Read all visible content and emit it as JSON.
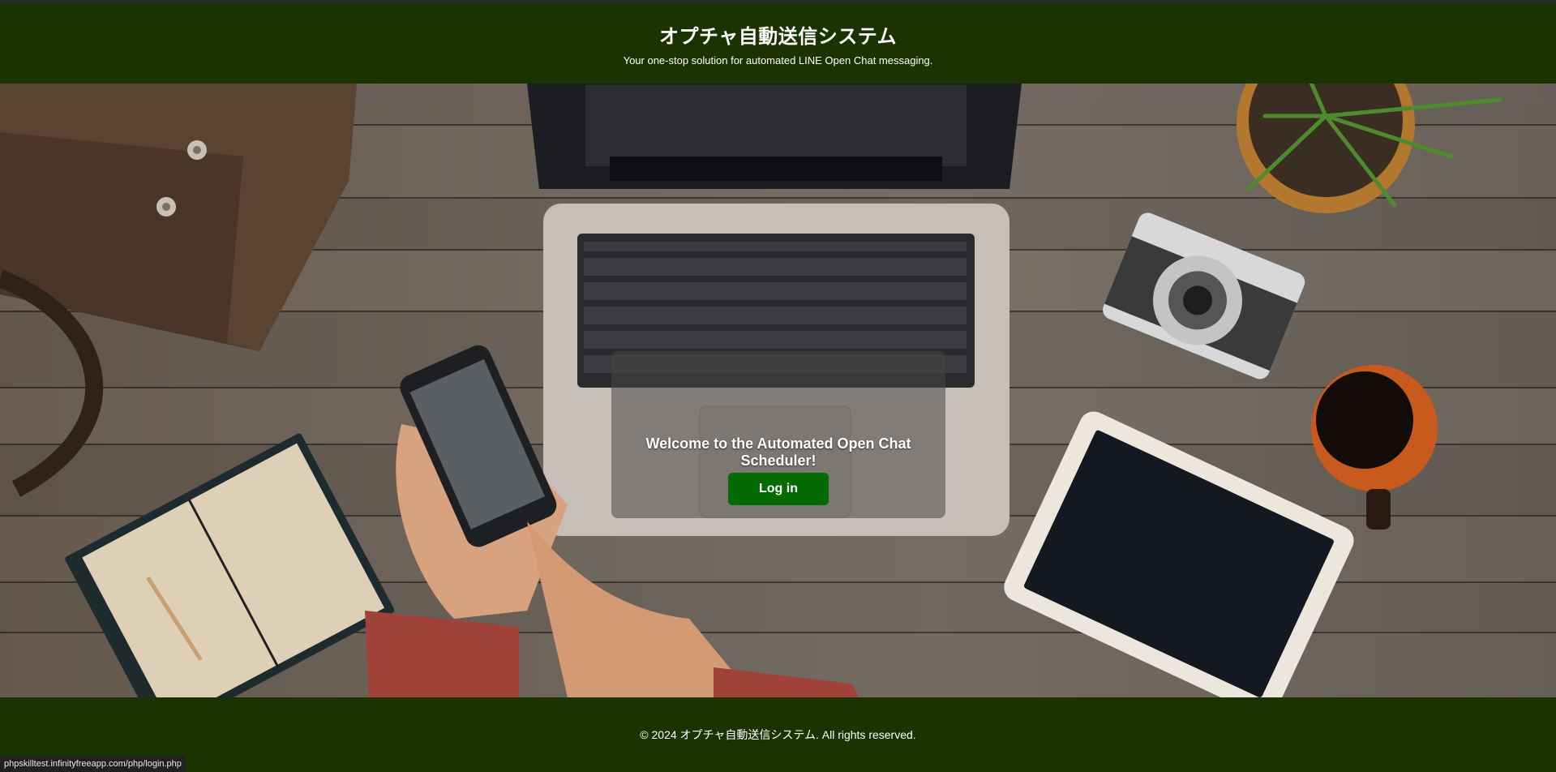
{
  "header": {
    "title": "オプチャ自動送信システム",
    "tagline": "Your one-stop solution for automated LINE Open Chat messaging."
  },
  "hero": {
    "welcome": "Welcome to the Automated Open Chat Scheduler!",
    "login_label": "Log in"
  },
  "footer": {
    "copyright": "© 2024 オプチャ自動送信システム. All rights reserved."
  },
  "status_bar": {
    "url": "phpskilltest.infinityfreeapp.com/php/login.php"
  },
  "colors": {
    "header_bg": "#1a3300",
    "button_bg": "#046b04",
    "text": "#ffffff"
  }
}
